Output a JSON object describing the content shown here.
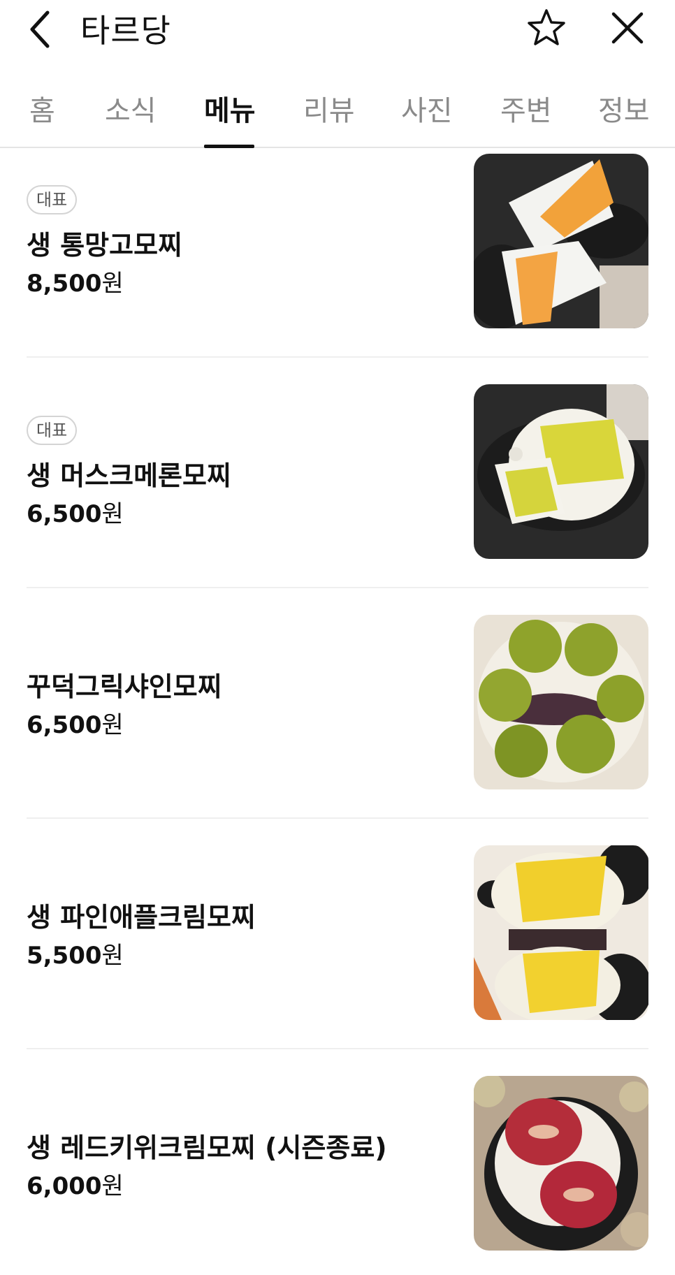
{
  "header": {
    "title": "타르당",
    "back_icon": "chevron-left-icon",
    "favorite_icon": "star-outline-icon",
    "close_icon": "close-icon"
  },
  "tabs": [
    {
      "label": "홈"
    },
    {
      "label": "소식"
    },
    {
      "label": "메뉴",
      "active": true
    },
    {
      "label": "리뷰"
    },
    {
      "label": "사진"
    },
    {
      "label": "주변"
    },
    {
      "label": "정보"
    }
  ],
  "menu": {
    "items": [
      {
        "badge": "대표",
        "name": "생 통망고모찌",
        "price": "8,500",
        "currency": "원",
        "image": "mango-mochi-photo"
      },
      {
        "badge": "대표",
        "name": "생 머스크메론모찌",
        "price": "6,500",
        "currency": "원",
        "image": "melon-mochi-photo"
      },
      {
        "name": "꾸덕그릭샤인모찌",
        "price": "6,500",
        "currency": "원",
        "image": "shine-muscat-mochi-photo"
      },
      {
        "name": "생 파인애플크림모찌",
        "price": "5,500",
        "currency": "원",
        "image": "pineapple-mochi-photo"
      },
      {
        "name": "생 레드키위크림모찌 (시즌종료)",
        "price": "6,000",
        "currency": "원",
        "image": "red-kiwi-mochi-photo"
      }
    ]
  },
  "colors": {
    "text": "#111111",
    "inactive_tab": "#8a8a8a",
    "divider": "#efefef"
  }
}
